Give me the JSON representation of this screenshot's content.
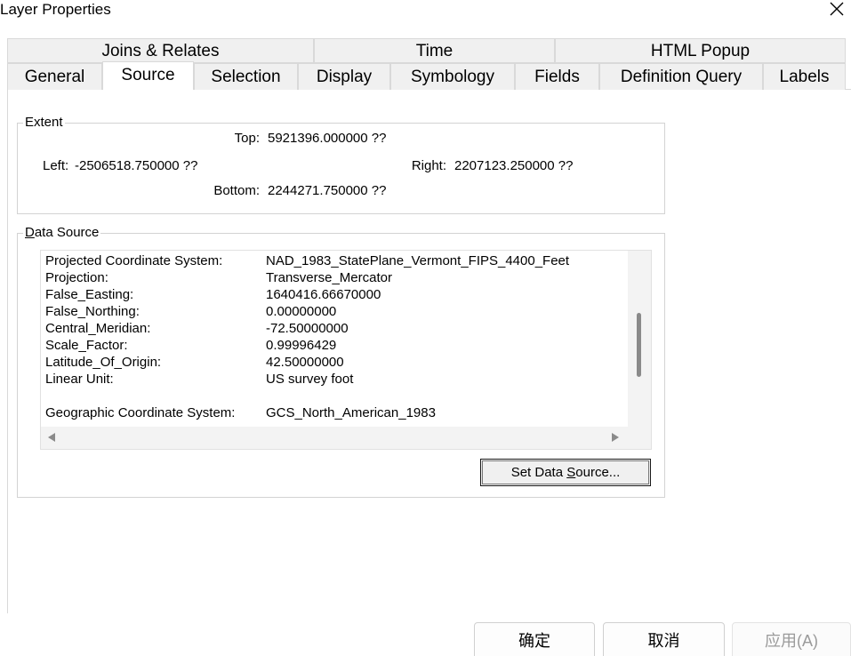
{
  "window": {
    "title": "Layer Properties"
  },
  "tabs": {
    "back_row": [
      "Joins & Relates",
      "Time",
      "HTML Popup"
    ],
    "front_row": [
      "General",
      "Source",
      "Selection",
      "Display",
      "Symbology",
      "Fields",
      "Definition Query",
      "Labels"
    ],
    "active": "Source"
  },
  "extent": {
    "legend": "Extent",
    "top_label": "Top:",
    "top_value": "5921396.000000 ??",
    "left_label": "Left:",
    "left_value": "-2506518.750000 ??",
    "right_label": "Right:",
    "right_value": "2207123.250000 ??",
    "bottom_label": "Bottom:",
    "bottom_value": "2244271.750000 ??"
  },
  "data_source": {
    "legend_key": "D",
    "legend_rest": "ata Source",
    "rows": [
      {
        "label": "Projected Coordinate System:",
        "value": "NAD_1983_StatePlane_Vermont_FIPS_4400_Feet"
      },
      {
        "label": "Projection:",
        "value": "Transverse_Mercator"
      },
      {
        "label": "False_Easting:",
        "value": "1640416.66670000"
      },
      {
        "label": "False_Northing:",
        "value": "0.00000000"
      },
      {
        "label": "Central_Meridian:",
        "value": "-72.50000000"
      },
      {
        "label": "Scale_Factor:",
        "value": "0.99996429"
      },
      {
        "label": "Latitude_Of_Origin:",
        "value": "42.50000000"
      },
      {
        "label": "Linear Unit:",
        "value": "US survey foot"
      },
      {
        "label": "",
        "value": ""
      },
      {
        "label": "Geographic Coordinate System:",
        "value": "GCS_North_American_1983"
      }
    ],
    "set_button_pre": "Set Data ",
    "set_button_key": "S",
    "set_button_post": "ource..."
  },
  "buttons": {
    "ok": "确定",
    "cancel": "取消",
    "apply": "应用(A)"
  },
  "colors": {
    "tab_bg": "#f0f0f0",
    "border": "#d9d9d9",
    "disabled_text": "#9a9a9a"
  }
}
